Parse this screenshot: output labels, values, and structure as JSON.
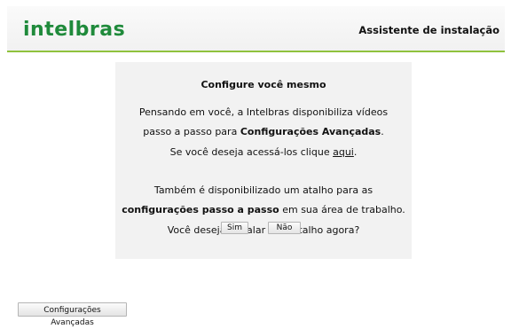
{
  "header": {
    "logo_text": "intelbras",
    "title": "Assistente de instalação",
    "accent_color": "#8fc23d",
    "logo_color": "#1f8a3b"
  },
  "panel": {
    "title": "Configure você mesmo",
    "para1": {
      "line1": "Pensando em você, a Intelbras disponibiliza vídeos",
      "line2_prefix": "passo a passo para ",
      "line2_bold": "Configurações Avançadas",
      "line2_suffix": ".",
      "line3_prefix": "Se você deseja acessá-los clique ",
      "line3_link": "aqui",
      "line3_suffix": "."
    },
    "para2": {
      "line1": "Também é disponibilizado um atalho para as",
      "line2_bold": "configurações passo a passo",
      "line2_suffix": " em sua área de trabalho.",
      "line3": "Você deseja instalar este atalho agora?"
    },
    "buttons": {
      "yes": "Sim",
      "no": "Não"
    }
  },
  "footer": {
    "advanced_button": "Configurações Avançadas"
  }
}
